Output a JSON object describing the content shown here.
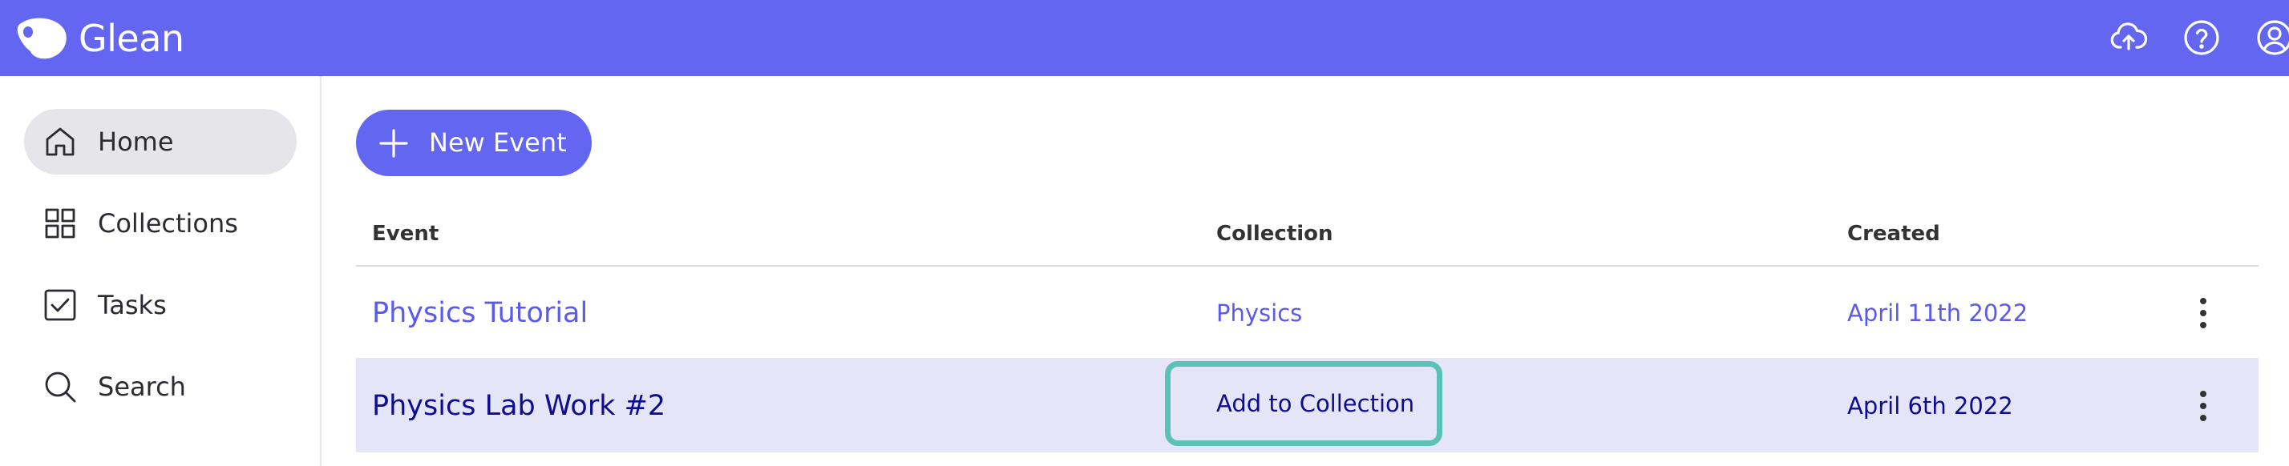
{
  "app": {
    "brand_name": "Glean",
    "accent_color": "#6366f1",
    "highlight_color": "#5cc2b8"
  },
  "topbar": {
    "icons": [
      "cloud-upload-icon",
      "help-icon",
      "user-account-icon"
    ]
  },
  "sidebar": {
    "items": [
      {
        "label": "Home",
        "icon": "home-icon",
        "active": true
      },
      {
        "label": "Collections",
        "icon": "grid-icon",
        "active": false
      },
      {
        "label": "Tasks",
        "icon": "checkbox-icon",
        "active": false
      },
      {
        "label": "Search",
        "icon": "search-icon",
        "active": false
      }
    ]
  },
  "main": {
    "new_event_label": "New Event",
    "table": {
      "headers": {
        "event": "Event",
        "collection": "Collection",
        "created": "Created"
      },
      "rows": [
        {
          "event": "Physics Tutorial",
          "collection": "Physics",
          "created": "April 11th 2022"
        },
        {
          "event": "Physics Lab Work #2",
          "collection": "Add to Collection",
          "created": "April 6th 2022"
        }
      ]
    }
  }
}
